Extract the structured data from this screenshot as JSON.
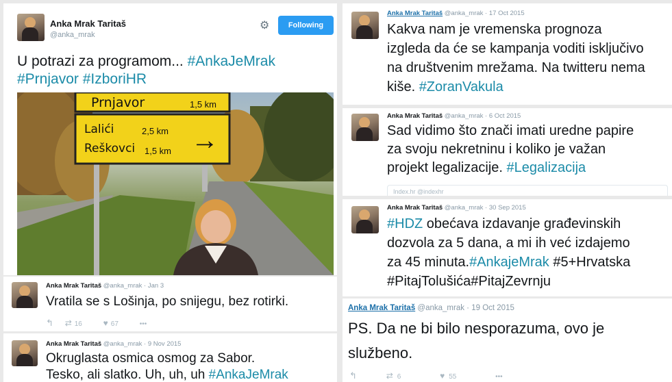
{
  "main_tweet": {
    "name": "Anka Mrak Taritaš",
    "handle": "@anka_mrak",
    "follow_label": "Following",
    "text_plain": "U potrazi za programom... ",
    "hashtags": [
      "#AnkaJeMrak",
      "#Prnjavor",
      "#IzboriHR"
    ],
    "sign": {
      "line1": "Prnjavor",
      "line1_dist": "1,5 km",
      "line2": "Lalići",
      "line2_dist": "2,5 km",
      "line3": "Reškovci",
      "line3_dist": "1,5 km"
    }
  },
  "tweet_jan": {
    "name": "Anka Mrak Taritaš",
    "handle_date": "@anka_mrak · Jan 3",
    "text": "Vratila se s Lošinja, po snijegu, bez rotirki.",
    "retweets": "16",
    "likes": "67"
  },
  "tweet_nov": {
    "name": "Anka Mrak Taritaš",
    "handle_date": "@anka_mrak · 9 Nov 2015",
    "line1": "Okruglasta osmica osmog za Sabor.",
    "line2_plain": "Tesko, ali slatko. Uh, uh, uh ",
    "line2_tag": "#AnkaJeMrak"
  },
  "tweet_17oct": {
    "name": "Anka Mrak Taritaš",
    "handle_date": "@anka_mrak · 17 Oct 2015",
    "line1": "Kakva nam je vremenska prognoza",
    "line2": "izgleda da će se kampanja voditi isključivo",
    "line3": "na društvenim mrežama. Na twitteru nema",
    "line4_plain": "kiše. ",
    "line4_tag": "#ZoranVakula"
  },
  "tweet_6oct": {
    "name": "Anka Mrak Taritaš",
    "handle_date": "@anka_mrak · 6 Oct 2015",
    "line1": "Sad vidimo što znači imati uredne papire",
    "line2": "za svoju nekretninu i koliko je važan",
    "line3_plain": "projekt legalizacije. ",
    "line3_tag": "#Legalizacija",
    "quote_stub": "Index.hr @indexhr"
  },
  "tweet_30sep": {
    "name": "Anka Mrak Taritaš",
    "handle_date": "@anka_mrak · 30 Sep 2015",
    "line1_tag": "#HDZ",
    "line1_plain": " obećava izdavanje građevinskih",
    "line2": "dozvola za 5 dana, a mi ih već izdajemo",
    "line3_plain": "za 45 minuta.",
    "line3_tag": "#AnkajeMrak",
    "line3_rest": " #5+Hrvatska",
    "line4": "#PitajTolušića#PitajZevrnju"
  },
  "tweet_19oct": {
    "name": "Anka Mrak Taritaš",
    "handle_date": "@anka_mrak · 19 Oct 2015",
    "line1": "PS. Da ne bi bilo nesporazuma, ovo je",
    "line2": "službeno.",
    "retweets": "6",
    "likes": "55"
  },
  "icons": {
    "reply": "↰",
    "retweet": "⇄",
    "like": "♥",
    "more": "•••",
    "gear": "⚙",
    "arrow": "→"
  }
}
